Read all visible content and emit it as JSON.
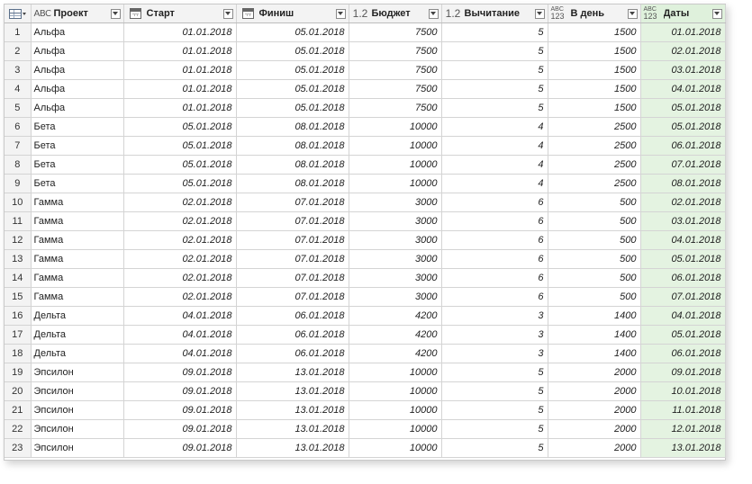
{
  "grid": {
    "columns": [
      {
        "label": "Проект",
        "type_icon": "text-type-icon",
        "type_glyph": "ABC"
      },
      {
        "label": "Старт",
        "type_icon": "date-type-icon"
      },
      {
        "label": "Финиш",
        "type_icon": "date-type-icon"
      },
      {
        "label": "Бюджет",
        "type_icon": "decimal-type-icon",
        "type_glyph": "1.2"
      },
      {
        "label": "Вычитание",
        "type_icon": "decimal-type-icon",
        "type_glyph": "1.2"
      },
      {
        "label": "В день",
        "type_icon": "any-type-icon",
        "type_glyph_top": "ABC",
        "type_glyph_bottom": "123"
      },
      {
        "label": "Даты",
        "type_icon": "any-type-icon",
        "type_glyph_top": "ABC",
        "type_glyph_bottom": "123"
      }
    ],
    "selected_column": "Даты",
    "selected_color": "#e4f3e1",
    "rows": [
      [
        "1",
        "Альфа",
        "01.01.2018",
        "05.01.2018",
        "7500",
        "5",
        "1500",
        "01.01.2018"
      ],
      [
        "2",
        "Альфа",
        "01.01.2018",
        "05.01.2018",
        "7500",
        "5",
        "1500",
        "02.01.2018"
      ],
      [
        "3",
        "Альфа",
        "01.01.2018",
        "05.01.2018",
        "7500",
        "5",
        "1500",
        "03.01.2018"
      ],
      [
        "4",
        "Альфа",
        "01.01.2018",
        "05.01.2018",
        "7500",
        "5",
        "1500",
        "04.01.2018"
      ],
      [
        "5",
        "Альфа",
        "01.01.2018",
        "05.01.2018",
        "7500",
        "5",
        "1500",
        "05.01.2018"
      ],
      [
        "6",
        "Бета",
        "05.01.2018",
        "08.01.2018",
        "10000",
        "4",
        "2500",
        "05.01.2018"
      ],
      [
        "7",
        "Бета",
        "05.01.2018",
        "08.01.2018",
        "10000",
        "4",
        "2500",
        "06.01.2018"
      ],
      [
        "8",
        "Бета",
        "05.01.2018",
        "08.01.2018",
        "10000",
        "4",
        "2500",
        "07.01.2018"
      ],
      [
        "9",
        "Бета",
        "05.01.2018",
        "08.01.2018",
        "10000",
        "4",
        "2500",
        "08.01.2018"
      ],
      [
        "10",
        "Гамма",
        "02.01.2018",
        "07.01.2018",
        "3000",
        "6",
        "500",
        "02.01.2018"
      ],
      [
        "11",
        "Гамма",
        "02.01.2018",
        "07.01.2018",
        "3000",
        "6",
        "500",
        "03.01.2018"
      ],
      [
        "12",
        "Гамма",
        "02.01.2018",
        "07.01.2018",
        "3000",
        "6",
        "500",
        "04.01.2018"
      ],
      [
        "13",
        "Гамма",
        "02.01.2018",
        "07.01.2018",
        "3000",
        "6",
        "500",
        "05.01.2018"
      ],
      [
        "14",
        "Гамма",
        "02.01.2018",
        "07.01.2018",
        "3000",
        "6",
        "500",
        "06.01.2018"
      ],
      [
        "15",
        "Гамма",
        "02.01.2018",
        "07.01.2018",
        "3000",
        "6",
        "500",
        "07.01.2018"
      ],
      [
        "16",
        "Дельта",
        "04.01.2018",
        "06.01.2018",
        "4200",
        "3",
        "1400",
        "04.01.2018"
      ],
      [
        "17",
        "Дельта",
        "04.01.2018",
        "06.01.2018",
        "4200",
        "3",
        "1400",
        "05.01.2018"
      ],
      [
        "18",
        "Дельта",
        "04.01.2018",
        "06.01.2018",
        "4200",
        "3",
        "1400",
        "06.01.2018"
      ],
      [
        "19",
        "Эпсилон",
        "09.01.2018",
        "13.01.2018",
        "10000",
        "5",
        "2000",
        "09.01.2018"
      ],
      [
        "20",
        "Эпсилон",
        "09.01.2018",
        "13.01.2018",
        "10000",
        "5",
        "2000",
        "10.01.2018"
      ],
      [
        "21",
        "Эпсилон",
        "09.01.2018",
        "13.01.2018",
        "10000",
        "5",
        "2000",
        "11.01.2018"
      ],
      [
        "22",
        "Эпсилон",
        "09.01.2018",
        "13.01.2018",
        "10000",
        "5",
        "2000",
        "12.01.2018"
      ],
      [
        "23",
        "Эпсилон",
        "09.01.2018",
        "13.01.2018",
        "10000",
        "5",
        "2000",
        "13.01.2018"
      ]
    ]
  }
}
